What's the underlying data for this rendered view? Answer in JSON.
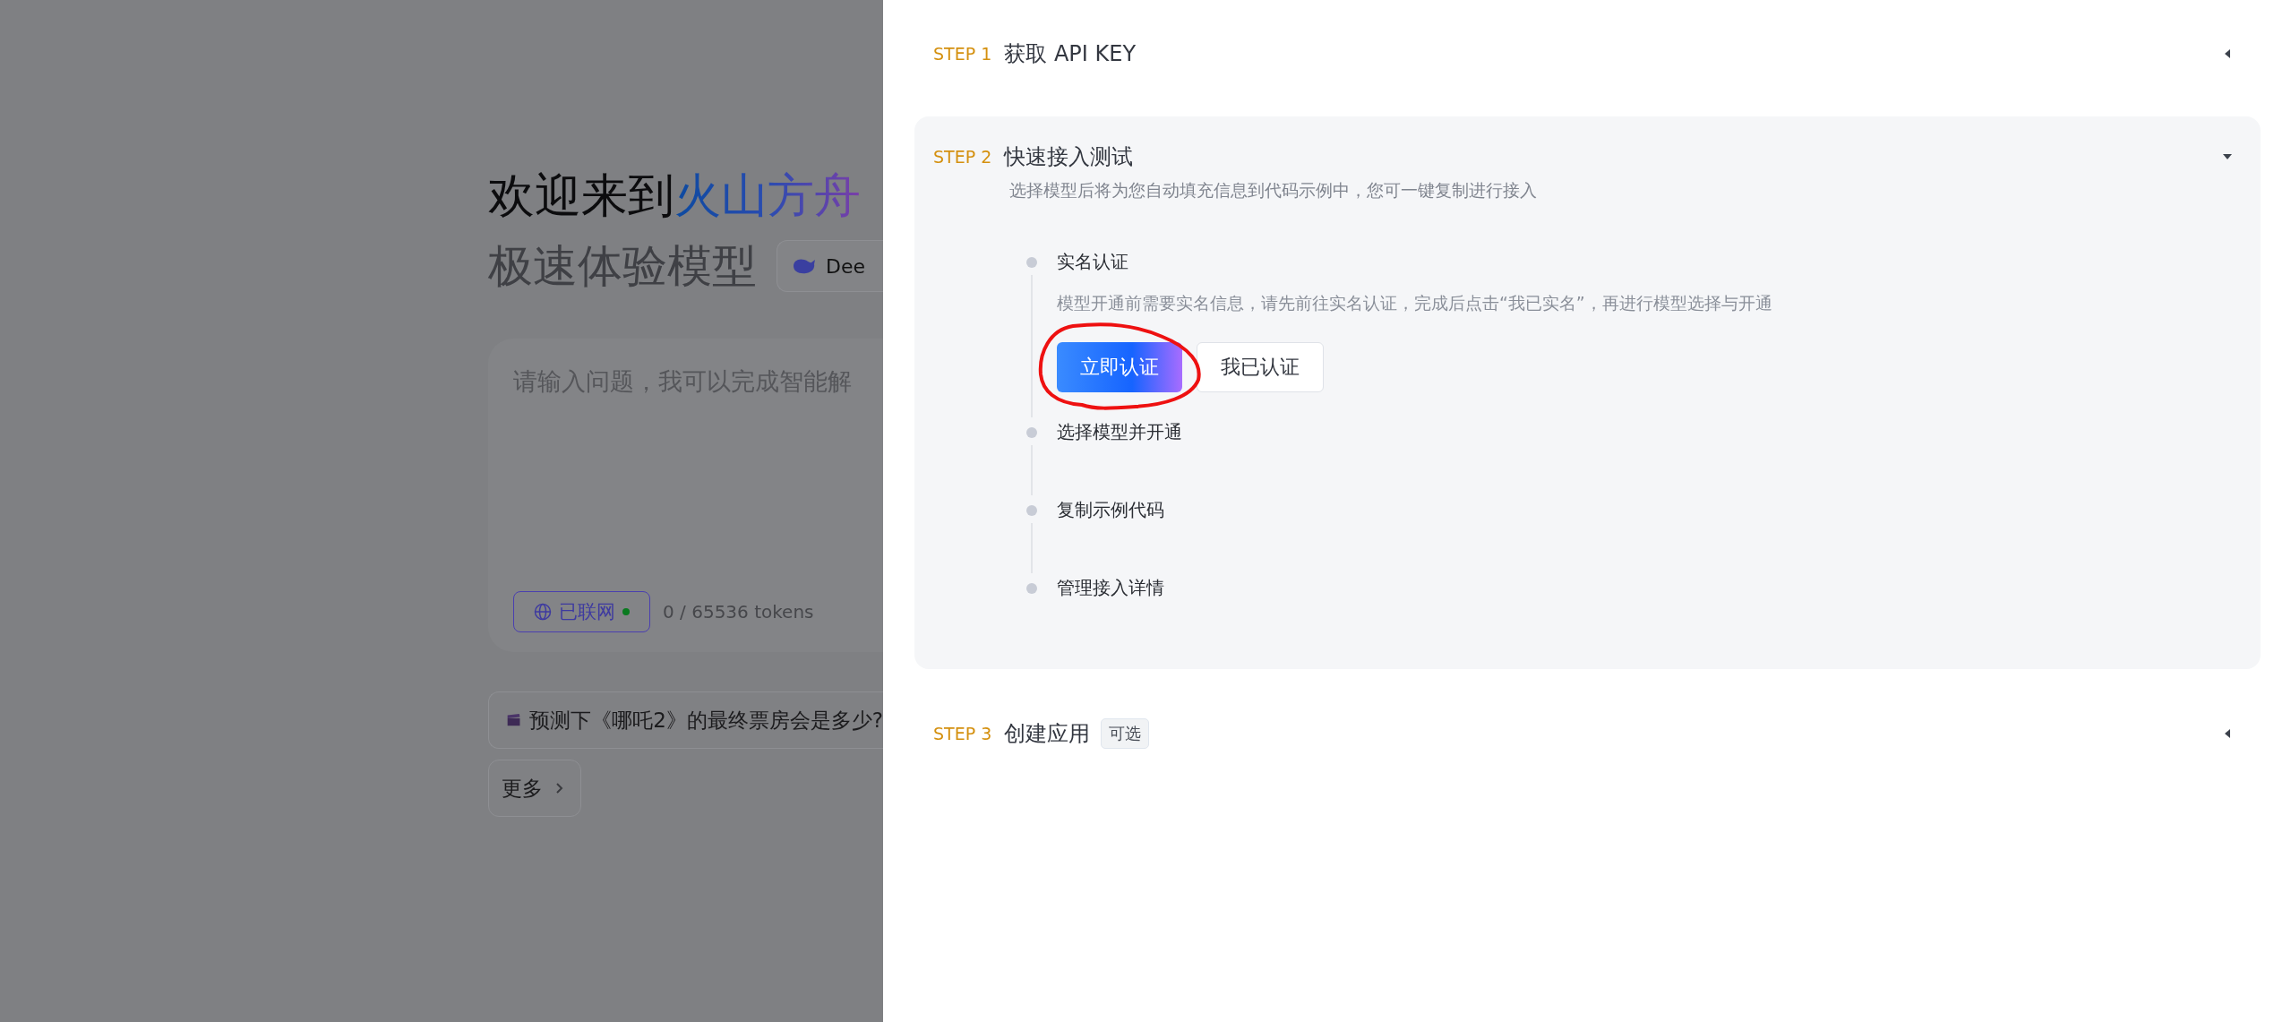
{
  "page": {
    "title_prefix": "欢迎来到",
    "title_highlight": "火山方舟",
    "subtitle": "极速体验模型",
    "model_selector": {
      "label": "Dee"
    },
    "prompt": {
      "placeholder": "请输入问题，我可以完成智能解",
      "web_toggle": {
        "label": "已联网",
        "on": true
      },
      "token_count": "0 / 65536 tokens"
    },
    "suggestions": [
      {
        "text": "预测下《哪吒2》的最终票房会是多少?"
      }
    ],
    "more_button": "更多"
  },
  "drawer": {
    "steps": [
      {
        "label": "STEP 1",
        "title": "获取 API KEY",
        "expanded": false
      },
      {
        "label": "STEP 2",
        "title": "快速接入测试",
        "expanded": true,
        "description": "选择模型后将为您自动填充信息到代码示例中，您可一键复制进行接入",
        "tasks": [
          {
            "title": "实名认证",
            "description": "模型开通前需要实名信息，请先前往实名认证，完成后点击“我已实名”，再进行模型选择与开通",
            "buttons": [
              {
                "label": "立即认证",
                "kind": "primary"
              },
              {
                "label": "我已认证",
                "kind": "secondary"
              }
            ]
          },
          {
            "title": "选择模型并开通"
          },
          {
            "title": "复制示例代码"
          },
          {
            "title": "管理接入详情"
          }
        ]
      },
      {
        "label": "STEP 3",
        "title": "创建应用",
        "tag": "可选",
        "expanded": false
      }
    ]
  }
}
